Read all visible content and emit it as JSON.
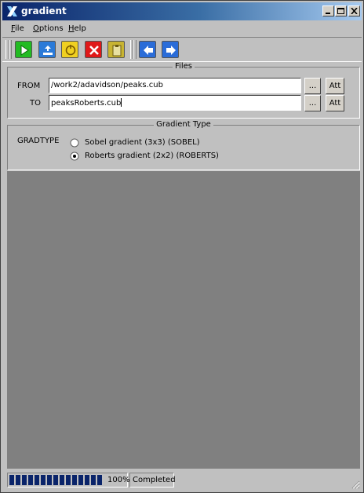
{
  "window": {
    "title": "gradient",
    "controls": [
      "minimize",
      "maximize",
      "close"
    ]
  },
  "menu": {
    "items": [
      "File",
      "Options",
      "Help"
    ]
  },
  "toolbar": {
    "buttons": [
      {
        "name": "run",
        "icon": "play-icon",
        "color": "#22bb22"
      },
      {
        "name": "reset",
        "icon": "reset-icon",
        "color": "#2a7ad8"
      },
      {
        "name": "stop",
        "icon": "stop-icon",
        "color": "#f0d020"
      },
      {
        "name": "exit",
        "icon": "close-icon",
        "color": "#e01818"
      },
      {
        "name": "clipboard",
        "icon": "clipboard-icon",
        "color": "#c8b432"
      },
      {
        "name": "back",
        "icon": "arrow-left-icon",
        "color": "#2a6cd8"
      },
      {
        "name": "forward",
        "icon": "arrow-right-icon",
        "color": "#2a6cd8"
      }
    ]
  },
  "files": {
    "title": "Files",
    "from_label": "FROM",
    "from_value": "/work2/adavidson/peaks.cub",
    "to_label": "TO",
    "to_value": "peaksRoberts.cub",
    "browse_label": "...",
    "att_label": "Att"
  },
  "gradient_type": {
    "title": "Gradient Type",
    "param_label": "GRADTYPE",
    "options": [
      {
        "label": "Sobel gradient (3x3) (SOBEL)",
        "selected": false
      },
      {
        "label": "Roberts gradient (2x2) (ROBERTS)",
        "selected": true
      }
    ]
  },
  "status": {
    "progress_percent": 100,
    "progress_text": "100%",
    "message": "Completed"
  }
}
